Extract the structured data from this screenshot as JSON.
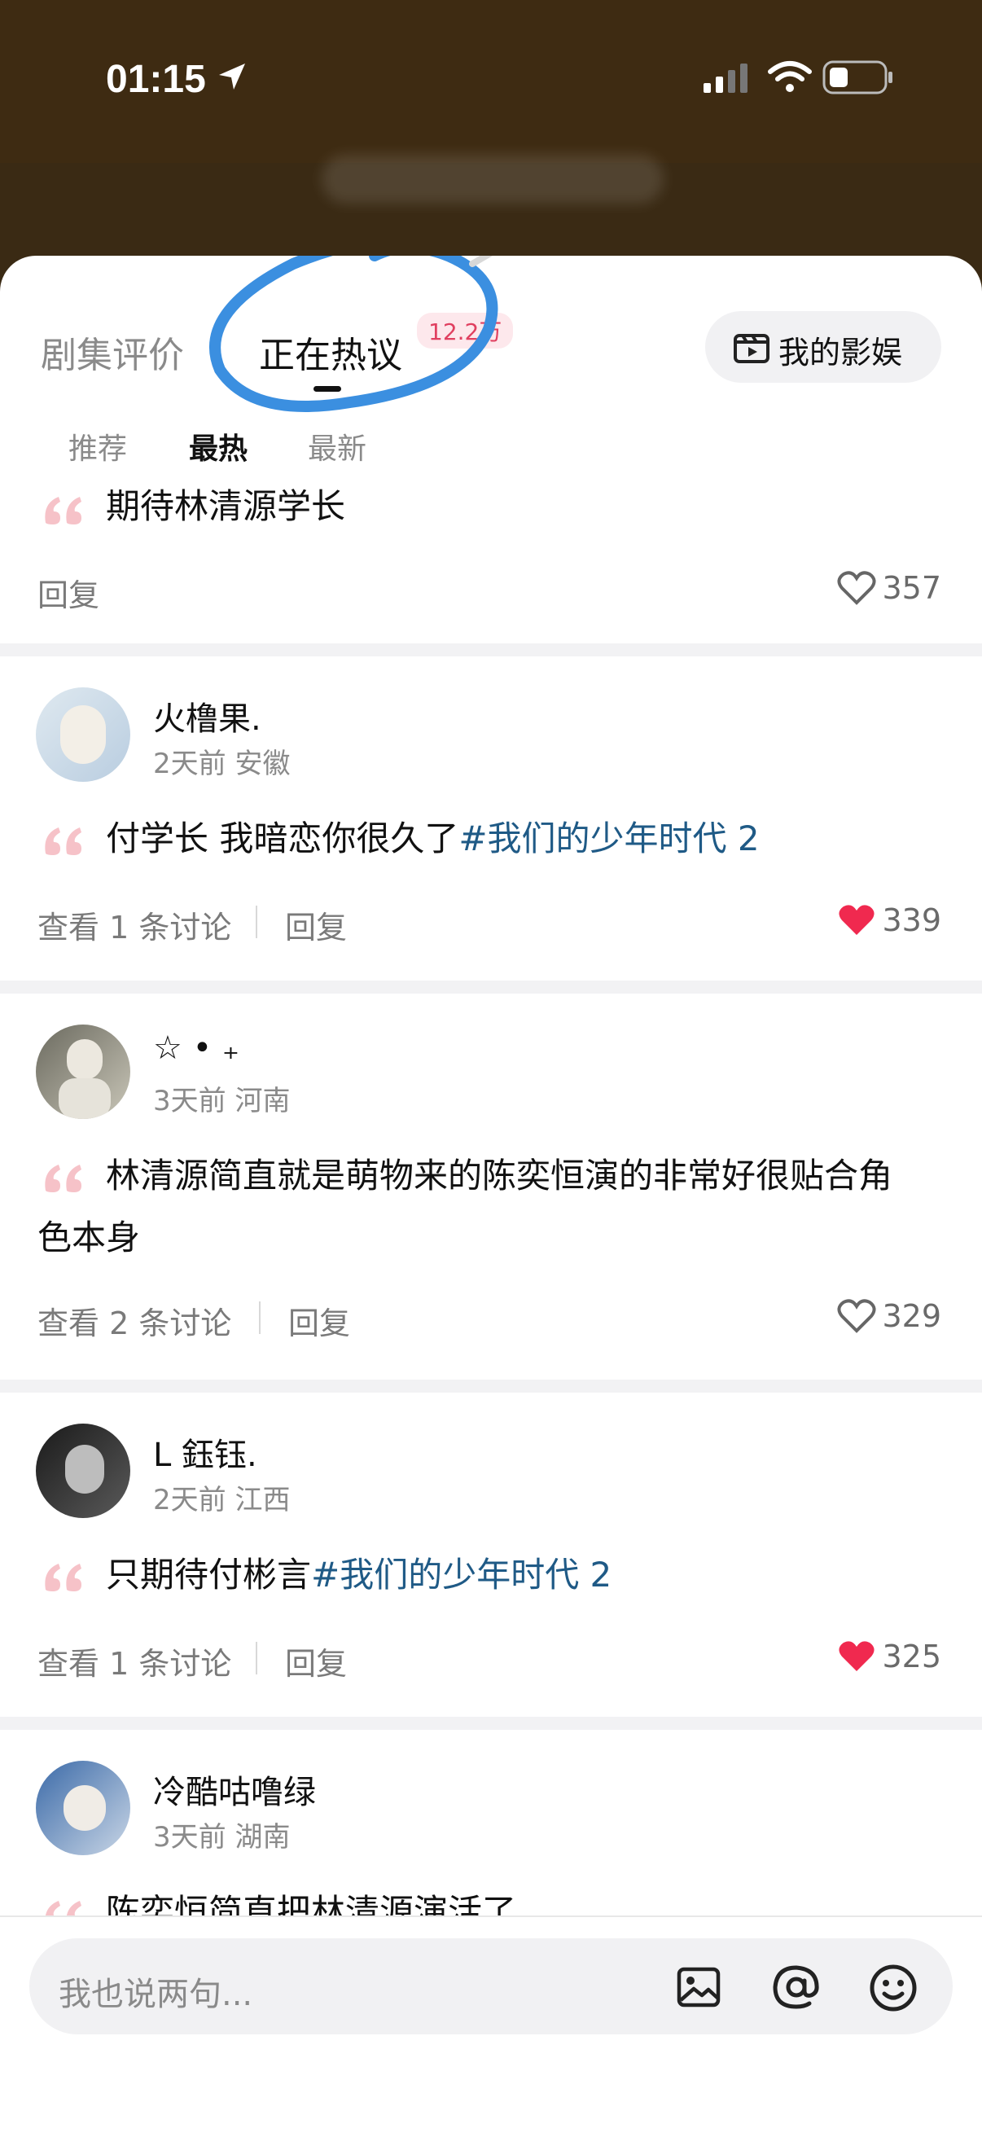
{
  "status_bar": {
    "time": "01:15"
  },
  "tabs": {
    "reviews": "剧集评价",
    "discussing": "正在热议",
    "hot_count": "12.2万",
    "my_entertainment": "我的影娱"
  },
  "sort": {
    "recommend": "推荐",
    "hottest": "最热",
    "latest": "最新"
  },
  "comments": [
    {
      "user": "",
      "meta": "",
      "text": "期待林清源学长",
      "tag": "",
      "view": "",
      "reply": "回复",
      "likes": "357",
      "liked": false
    },
    {
      "user": "火橹果.",
      "meta": "2天前 安徽",
      "text": "付学长 我暗恋你很久了",
      "tag": "#我们的少年时代 2",
      "view": "查看 1 条讨论",
      "reply": "回复",
      "likes": "339",
      "liked": true
    },
    {
      "user": "☆ • ₊",
      "meta": "3天前 河南",
      "text": "林清源简直就是萌物来的陈奕恒演的非常好很贴合角色本身",
      "tag": "",
      "view": "查看 2 条讨论",
      "reply": "回复",
      "likes": "329",
      "liked": false
    },
    {
      "user": "L 鈺钰.",
      "meta": "2天前 江西",
      "text": "只期待付彬言",
      "tag": "#我们的少年时代 2",
      "view": "查看 1 条讨论",
      "reply": "回复",
      "likes": "325",
      "liked": true
    },
    {
      "user": "冷酷咕噜绿",
      "meta": "3天前 湖南",
      "text": "陈奕恒简直把林清源演活了"
    }
  ],
  "composer": {
    "placeholder": "我也说两句..."
  },
  "icons": {
    "location": "location-arrow-icon",
    "signal": "signal-icon",
    "wifi": "wifi-icon",
    "battery": "battery-icon",
    "entertainment": "film-icon",
    "quote": "quote-icon",
    "heart": "heart-icon",
    "image": "image-icon",
    "mention": "at-icon",
    "emoji": "emoji-icon"
  },
  "colors": {
    "header_bg": "#3e2b12",
    "liked": "#f0294f",
    "tag": "#1f5a86",
    "annotation": "#3b8fe0"
  }
}
